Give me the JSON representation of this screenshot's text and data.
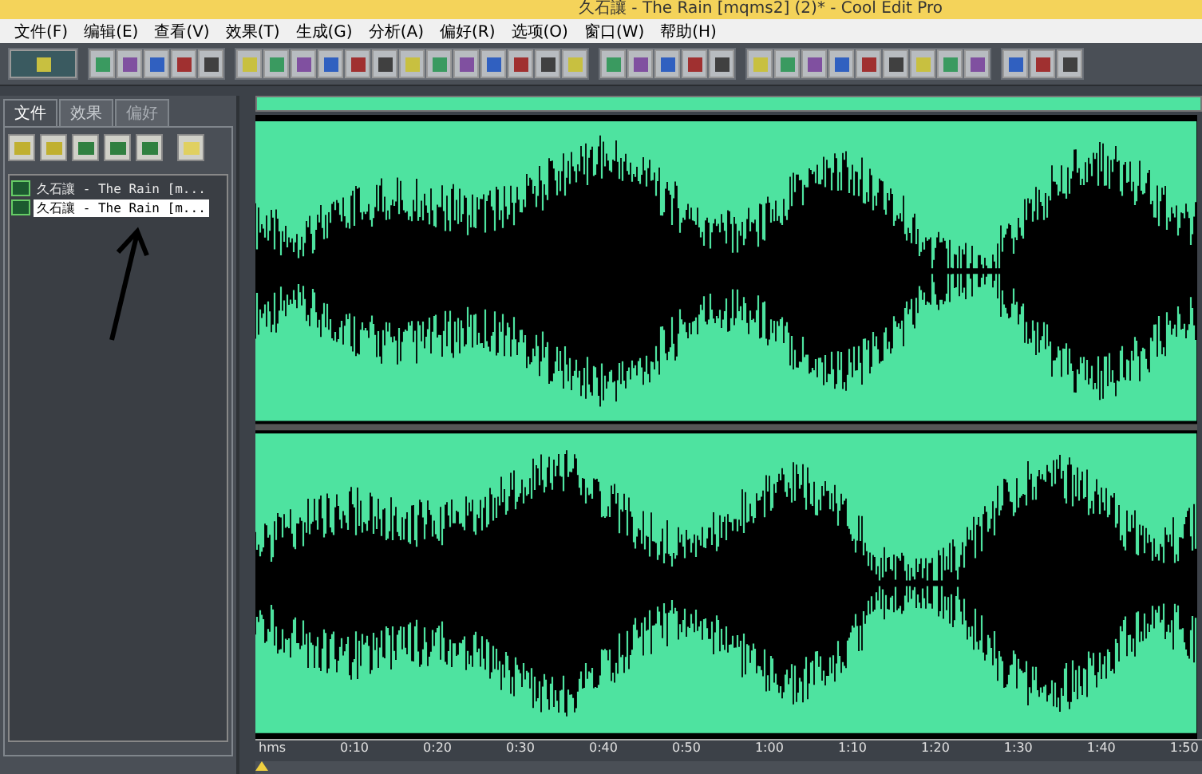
{
  "window": {
    "title": "久石讓 - The Rain [mqms2] (2)* - Cool Edit Pro"
  },
  "menu": [
    "文件(F)",
    "编辑(E)",
    "查看(V)",
    "效果(T)",
    "生成(G)",
    "分析(A)",
    "偏好(R)",
    "选项(O)",
    "窗口(W)",
    "帮助(H)"
  ],
  "tabs": [
    {
      "label": "文件",
      "selected": true,
      "disabled": false
    },
    {
      "label": "效果",
      "selected": false,
      "disabled": false
    },
    {
      "label": "偏好",
      "selected": false,
      "disabled": true
    }
  ],
  "files": [
    {
      "name": "久石讓 - The Rain [m...",
      "selected": false
    },
    {
      "name": "久石讓 - The Rain [m...",
      "selected": true
    }
  ],
  "ruler": [
    "hms",
    "0:10",
    "0:20",
    "0:30",
    "0:40",
    "0:50",
    "1:00",
    "1:10",
    "1:20",
    "1:30",
    "1:40",
    "1:50"
  ]
}
